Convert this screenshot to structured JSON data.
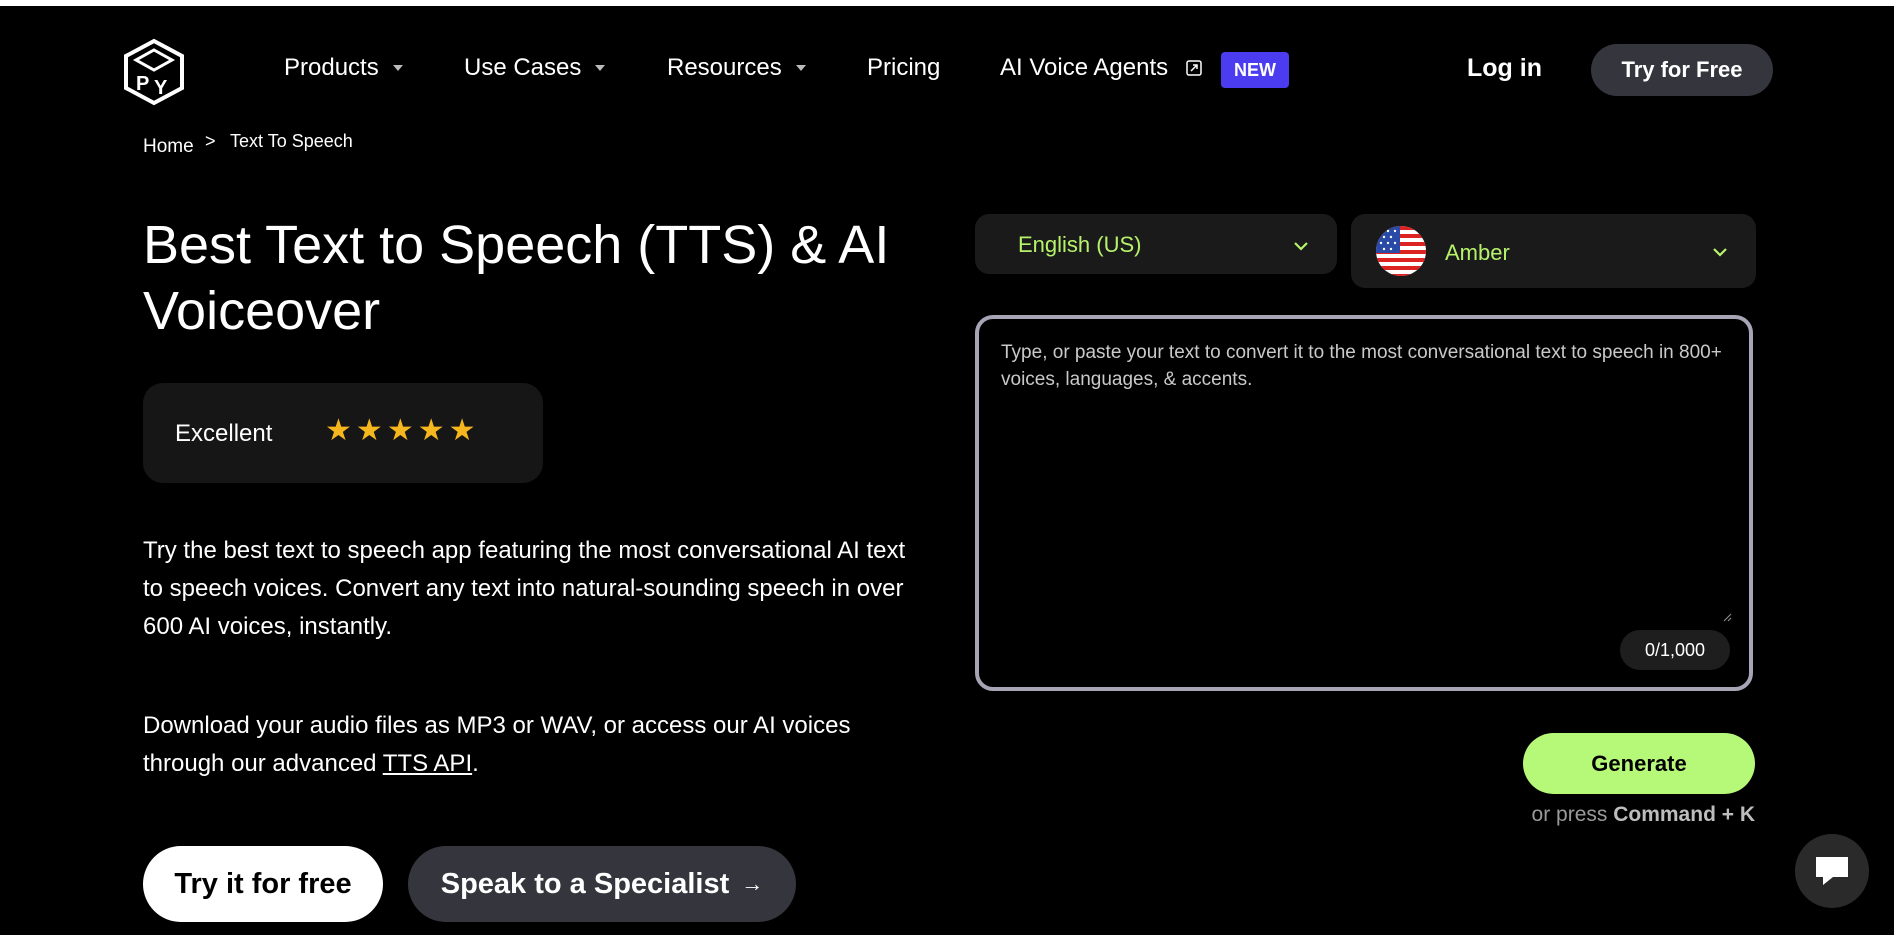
{
  "nav": {
    "items": [
      {
        "label": "Products",
        "has_caret": true
      },
      {
        "label": "Use Cases",
        "has_caret": true
      },
      {
        "label": "Resources",
        "has_caret": true
      },
      {
        "label": "Pricing",
        "has_caret": false
      },
      {
        "label": "AI Voice Agents",
        "has_caret": false
      }
    ],
    "new_badge": "NEW",
    "login": "Log in",
    "try_free": "Try for Free"
  },
  "breadcrumb": {
    "home": "Home",
    "separator": ">",
    "current": "Text To Speech"
  },
  "hero": {
    "title": "Best Text to Speech (TTS) & AI Voiceover",
    "rating_label": "Excellent",
    "rating_stars": 5,
    "description": "Try the best text to speech app featuring the most conversational AI text to speech voices. Convert any text into natural-sounding speech in over 600 AI voices, instantly.",
    "download_text_before": "Download your audio files as MP3 or WAV, or access our AI voices through our advanced ",
    "download_link": "TTS API",
    "download_text_after": ".",
    "cta_primary": "Try it for free",
    "cta_secondary": "Speak to a Specialist",
    "cta_secondary_arrow": "→"
  },
  "tts": {
    "language": "English (US)",
    "voice": "Amber",
    "placeholder": "Type, or paste your text to convert it to the most conversational text to speech in 800+ voices, languages, & accents.",
    "counter": "0/1,000",
    "generate": "Generate",
    "shortcut_prefix": "or press",
    "shortcut_key": "Command + K"
  },
  "colors": {
    "accent_green": "#b6f878",
    "select_text_green": "#b6f36a",
    "new_badge": "#4b3cf0",
    "star": "#f6b71e"
  },
  "icons": {
    "logo": "playht-logo-icon",
    "external": "external-link-icon",
    "chevron": "chevron-down-icon",
    "flag": "us-flag-icon",
    "chat": "chat-bubble-icon"
  }
}
